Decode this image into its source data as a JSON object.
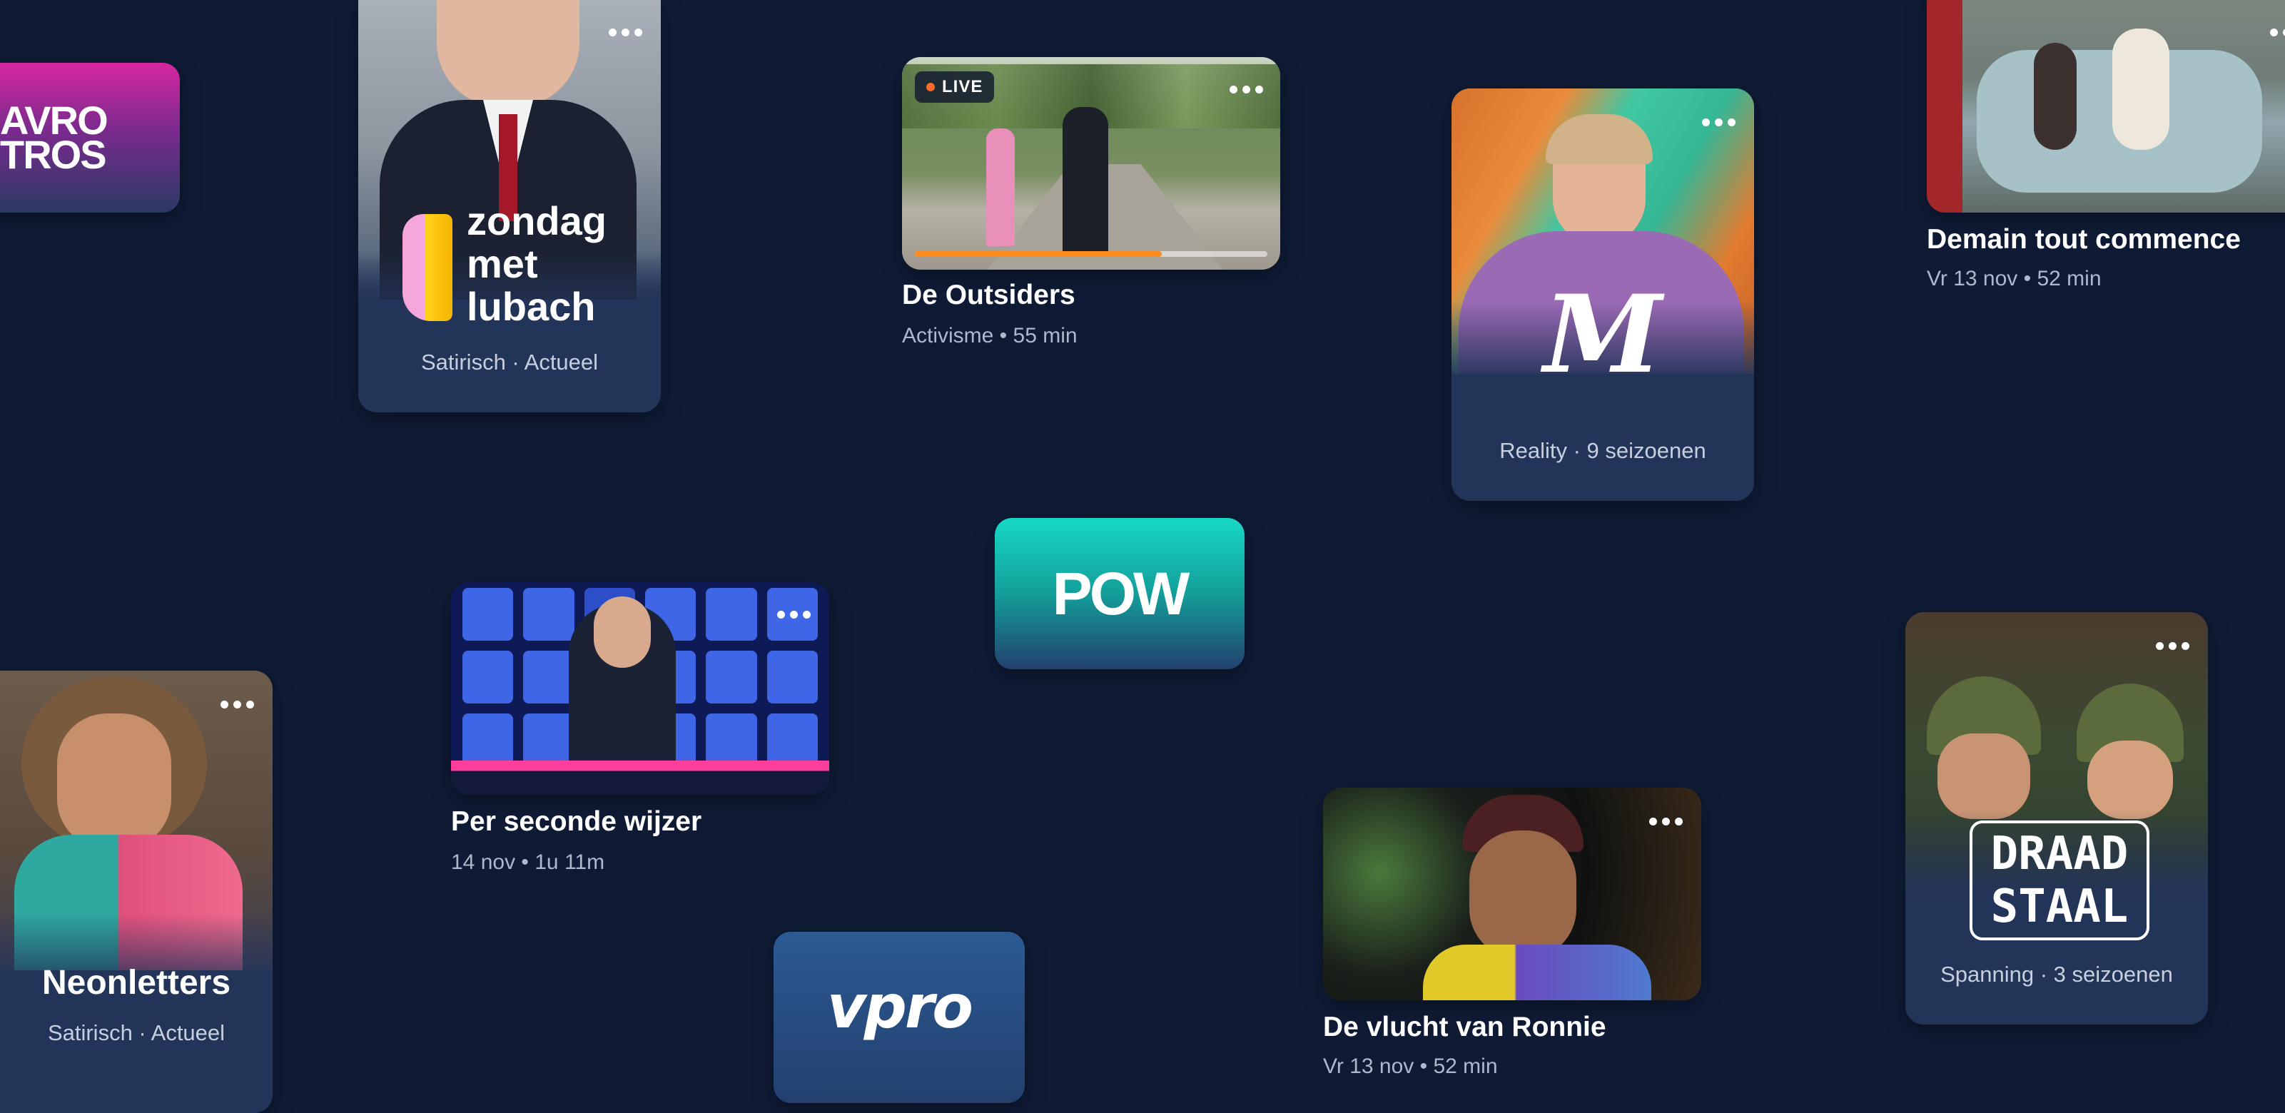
{
  "colors": {
    "background": "#0f1b35",
    "card": "#233459",
    "live_dot": "#ff6a2b",
    "progress": "#ff8a1e",
    "pow_teal": "#17d9c6",
    "avrotros_magenta": "#d6279f"
  },
  "logos": {
    "avrotros": {
      "line1": "AVRO",
      "line2": "TROS"
    },
    "pow": {
      "text": "POW"
    },
    "vpro": {
      "text": "vpro"
    }
  },
  "cards": {
    "zondag": {
      "logo_lines": [
        "zondag",
        "met",
        "lubach"
      ],
      "meta": "Satirisch · Actueel",
      "menu_icon": "more-dots-icon"
    },
    "outsiders": {
      "badge": "LIVE",
      "title": "De Outsiders",
      "meta": "Activisme • 55 min",
      "progress": 0.7,
      "menu_icon": "more-dots-icon"
    },
    "m_show": {
      "logo": "M",
      "meta": "Reality · 9 seizoenen",
      "menu_icon": "more-dots-icon"
    },
    "demain": {
      "title": "Demain tout commence",
      "meta": "Vr 13 nov • 52 min",
      "menu_icon": "more-dots-icon"
    },
    "per_seconde": {
      "title": "Per seconde wijzer",
      "meta": "14 nov • 1u 11m",
      "menu_icon": "more-dots-icon"
    },
    "neonletters": {
      "title": "Neonletters",
      "meta": "Satirisch · Actueel",
      "menu_icon": "more-dots-icon"
    },
    "ronnie": {
      "title": "De vlucht van Ronnie",
      "meta": "Vr 13 nov • 52 min",
      "menu_icon": "more-dots-icon"
    },
    "draadstaal": {
      "logo_lines": [
        "DRAAD",
        "STAAL"
      ],
      "meta": "Spanning · 3 seizoenen",
      "menu_icon": "more-dots-icon"
    }
  }
}
